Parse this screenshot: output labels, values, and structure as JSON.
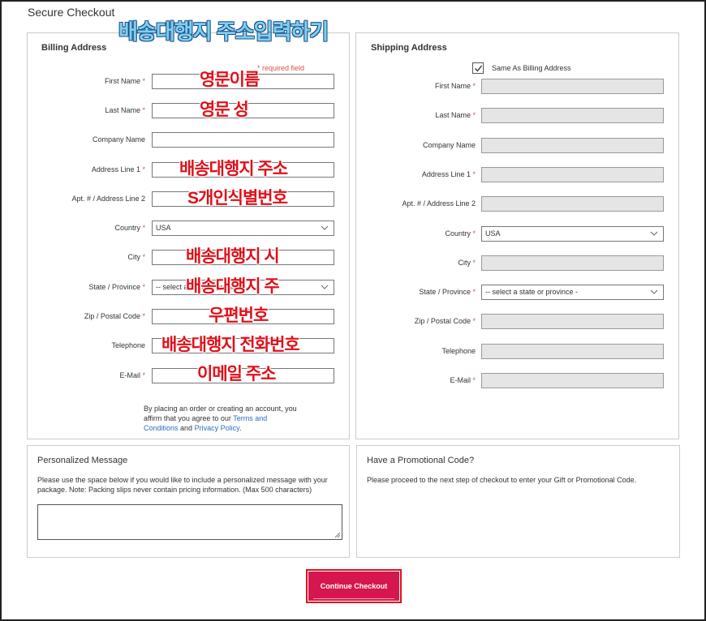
{
  "page": {
    "title": "Secure Checkout",
    "overlay_title": "배송대행지 주소입력하기"
  },
  "billing": {
    "title": "Billing Address",
    "required_note": "* required field",
    "fields": {
      "first_name": {
        "label": "First Name",
        "value": ""
      },
      "last_name": {
        "label": "Last Name",
        "value": ""
      },
      "company": {
        "label": "Company Name",
        "value": ""
      },
      "address1": {
        "label": "Address Line 1",
        "value": ""
      },
      "address2": {
        "label": "Apt. # / Address Line 2",
        "value": ""
      },
      "country": {
        "label": "Country",
        "value": "USA"
      },
      "city": {
        "label": "City",
        "value": ""
      },
      "state": {
        "label": "State / Province",
        "value": "-- select a state or province -"
      },
      "zip": {
        "label": "Zip / Postal Code",
        "value": ""
      },
      "telephone": {
        "label": "Telephone",
        "value": ""
      },
      "email": {
        "label": "E-Mail",
        "value": ""
      }
    },
    "overlays": {
      "first_name": "영문이름",
      "last_name": "영문 성",
      "address1": "배송대행지 주소",
      "address2": "S개인식별번호",
      "city": "배송대행지 시",
      "state": "배송대행지 주",
      "zip": "우편번호",
      "telephone": "배송대행지 전화번호",
      "email": "이메일 주소"
    },
    "agreement": {
      "line1": "By placing an order or creating an account, you",
      "line2_prefix": "affirm that you agree to our",
      "terms_link_a": "Terms and",
      "terms_link_b": "Conditions",
      "and": "and",
      "privacy_link": "Privacy Policy",
      "period": "."
    }
  },
  "shipping": {
    "title": "Shipping Address",
    "same_as_billing_label": "Same As Billing Address",
    "same_as_billing_checked": true,
    "fields": {
      "first_name": {
        "label": "First Name",
        "value": ""
      },
      "last_name": {
        "label": "Last Name",
        "value": ""
      },
      "company": {
        "label": "Company Name",
        "value": ""
      },
      "address1": {
        "label": "Address Line 1",
        "value": ""
      },
      "address2": {
        "label": "Apt. # / Address Line 2",
        "value": ""
      },
      "country": {
        "label": "Country",
        "value": "USA"
      },
      "city": {
        "label": "City",
        "value": ""
      },
      "state": {
        "label": "State / Province",
        "value": "-- select a state or province -"
      },
      "zip": {
        "label": "Zip / Postal Code",
        "value": ""
      },
      "telephone": {
        "label": "Telephone",
        "value": ""
      },
      "email": {
        "label": "E-Mail",
        "value": ""
      }
    }
  },
  "message": {
    "title": "Personalized Message",
    "desc_line1": "Please use the space below if you would like to include a personalized message with your",
    "desc_line2": "package. Note: Packing slips never contain pricing information. (Max 500 characters)",
    "value": ""
  },
  "promo": {
    "title": "Have a Promotional Code?",
    "desc": "Please proceed to the next step of checkout to enter your Gift or Promotional Code."
  },
  "continue_label": "Continue Checkout",
  "colors": {
    "accent": "#d6164e",
    "required": "#d9534f",
    "overlay_red": "#e0101a",
    "overlay_blue": "#7fd0f0"
  },
  "icons": {
    "checkbox": "check-icon",
    "select": "chevron-down-icon",
    "textarea": "resize-handle-icon"
  }
}
